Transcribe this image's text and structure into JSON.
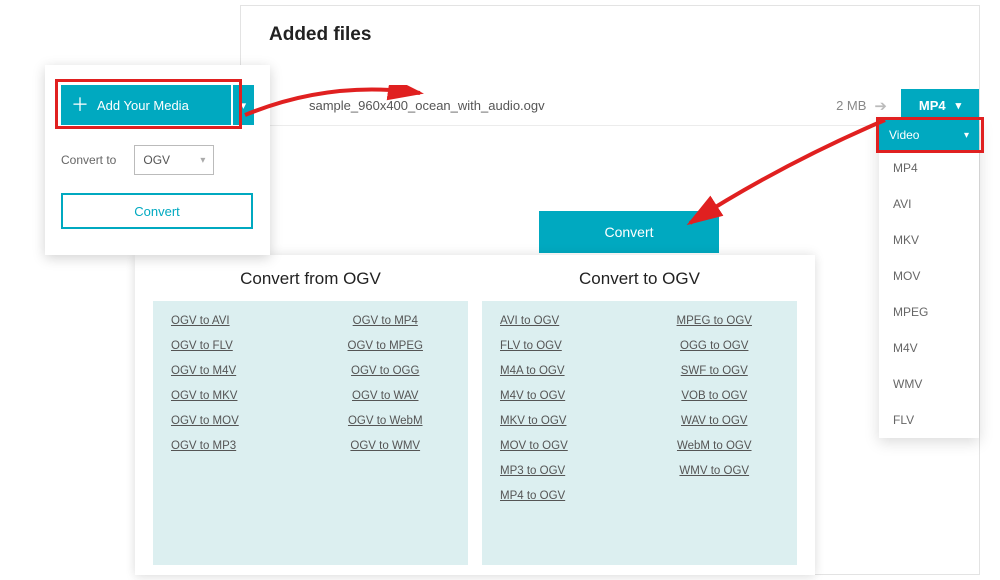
{
  "colors": {
    "accent": "#00a9c0",
    "highlight": "#e02020"
  },
  "sideCard": {
    "addMediaLabel": "Add Your Media",
    "convertToLabel": "Convert to",
    "selectedFormat": "OGV",
    "convertButton": "Convert"
  },
  "main": {
    "title": "Added files",
    "file": {
      "name": "sample_960x400_ocean_with_audio.ogv",
      "size": "2 MB"
    },
    "formatButton": "MP4",
    "convertButton": "Convert"
  },
  "formatDropdown": {
    "header": "Video",
    "items": [
      "MP4",
      "AVI",
      "MKV",
      "MOV",
      "MPEG",
      "M4V",
      "WMV",
      "FLV"
    ]
  },
  "bottom": {
    "leftTitle": "Convert from OGV",
    "rightTitle": "Convert to OGV",
    "fromLinks": [
      "OGV to AVI",
      "OGV to MP4",
      "OGV to FLV",
      "OGV to MPEG",
      "OGV to M4V",
      "OGV to OGG",
      "OGV to MKV",
      "OGV to WAV",
      "OGV to MOV",
      "OGV to WebM",
      "OGV to MP3",
      "OGV to WMV"
    ],
    "toLinks": [
      "AVI to OGV",
      "MPEG to OGV",
      "FLV to OGV",
      "OGG to OGV",
      "M4A to OGV",
      "SWF to OGV",
      "M4V to OGV",
      "VOB to OGV",
      "MKV to OGV",
      "WAV to OGV",
      "MOV to OGV",
      "WebM to OGV",
      "MP3 to OGV",
      "WMV to OGV",
      "MP4 to OGV",
      ""
    ]
  }
}
